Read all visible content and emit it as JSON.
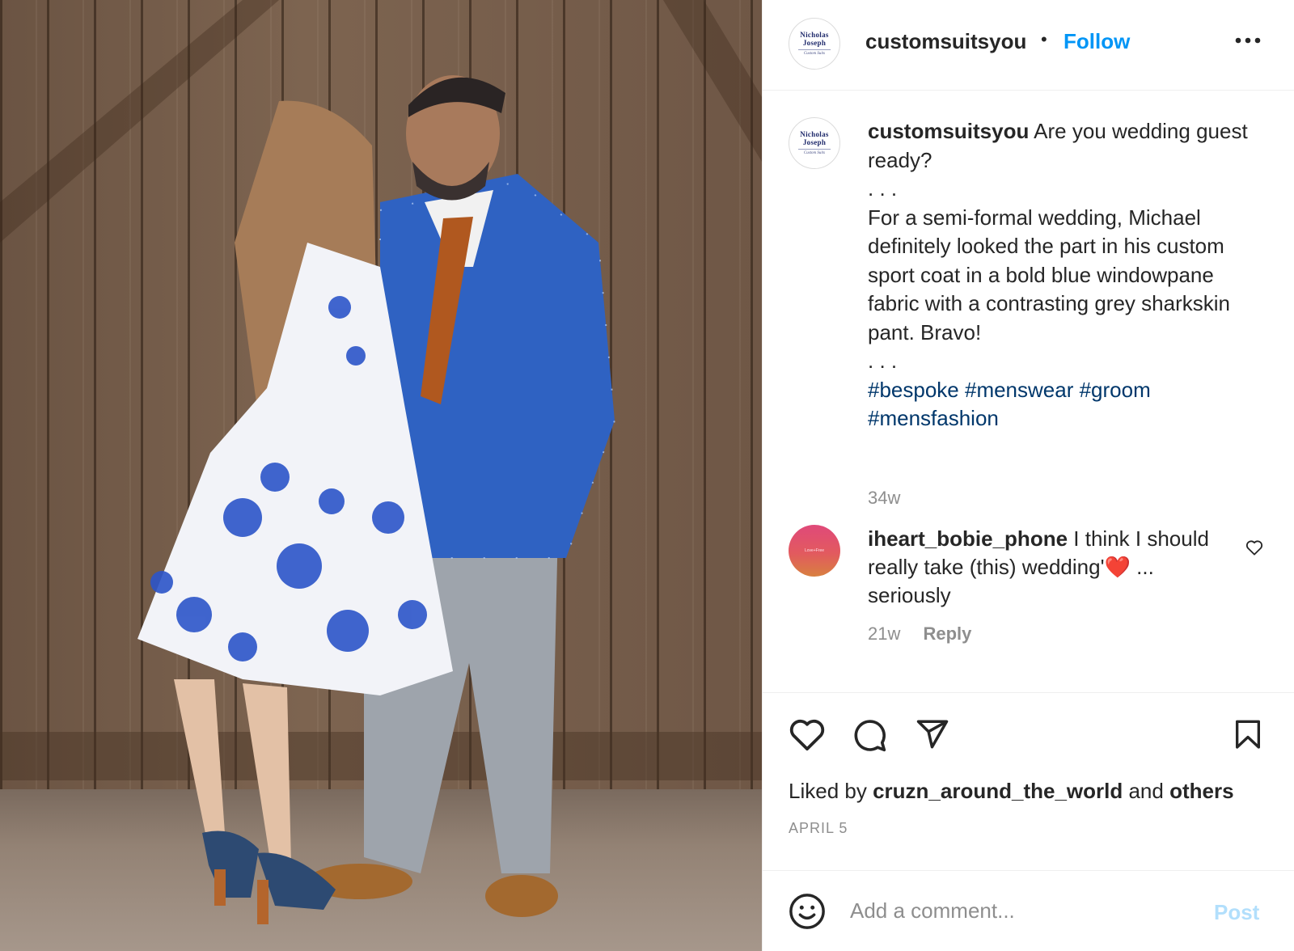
{
  "post": {
    "author": "customsuitsyou",
    "follow_label": "Follow",
    "separator": "•",
    "logo": {
      "line1": "Nicholas",
      "line2": "Joseph",
      "line3": "Custom Suits"
    }
  },
  "caption": {
    "username": "customsuitsyou",
    "line1": "Are you wedding guest ready?",
    "dots1": ". . .",
    "body": "For a semi-formal wedding, Michael definitely looked the part in his custom sport coat in a bold blue windowpane fabric with a contrasting grey sharkskin pant. Bravo!",
    "dots2": ". . .",
    "hashtags": "#bespoke #menswear #groom #mensfashion",
    "time": "34w"
  },
  "comment": {
    "username": "iheart_bobie_phone",
    "text_before": "I think I should really take (this) wedding'",
    "emoji": "❤️",
    "text_after": " ... seriously",
    "avatar_text": "Love+Free",
    "time": "21w",
    "reply_label": "Reply"
  },
  "likes": {
    "prefix": "Liked by",
    "user": "cruzn_around_the_world",
    "and": "and",
    "others": "others"
  },
  "date": "APRIL 5",
  "add_comment": {
    "placeholder": "Add a comment...",
    "post_label": "Post"
  },
  "colors": {
    "link_blue": "#0095f6",
    "hashtag": "#00376b",
    "muted": "#8e8e8e",
    "post_disabled": "#b2dffc"
  },
  "icons": {
    "more": "more-icon",
    "heart": "heart-icon",
    "comment": "comment-icon",
    "share": "share-icon",
    "bookmark": "bookmark-icon",
    "emoji": "emoji-icon",
    "comment_like": "comment-like-icon"
  }
}
